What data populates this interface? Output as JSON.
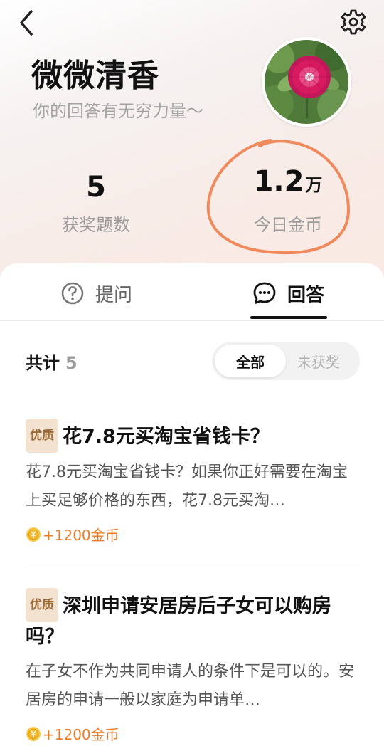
{
  "profile": {
    "name": "微微清香",
    "signature": "你的回答有无穷力量～"
  },
  "stats": [
    {
      "value": "5",
      "unit": "",
      "label": "获奖题数"
    },
    {
      "value": "1.2",
      "unit": "万",
      "label": "今日金币"
    }
  ],
  "tabs": [
    {
      "label": "提问",
      "icon": "question-circle-icon",
      "active": false
    },
    {
      "label": "回答",
      "icon": "chat-bubble-icon",
      "active": true
    }
  ],
  "summary": {
    "label": "共计",
    "count": "5"
  },
  "filter": {
    "options": [
      "全部",
      "未获奖"
    ],
    "selected": "全部"
  },
  "answers": [
    {
      "badge": "优质",
      "title": "花7.8元买淘宝省钱卡？",
      "excerpt": "花7.8元买淘宝省钱卡？如果你正好需要在淘宝上买足够价格的东西，花7.8元买淘…",
      "reward": "+1200金币"
    },
    {
      "badge": "优质",
      "title": "深圳申请安居房后子女可以购房吗？",
      "excerpt": "在子女不作为共同申请人的条件下是可以的。安居房的申请一般以家庭为申请单…",
      "reward": "+1200金币"
    }
  ],
  "colors": {
    "accent_orange": "#f07b23",
    "annotation_circle": "#f0895b",
    "badge_bg": "#f3e2cf",
    "badge_text": "#9b6a35"
  }
}
